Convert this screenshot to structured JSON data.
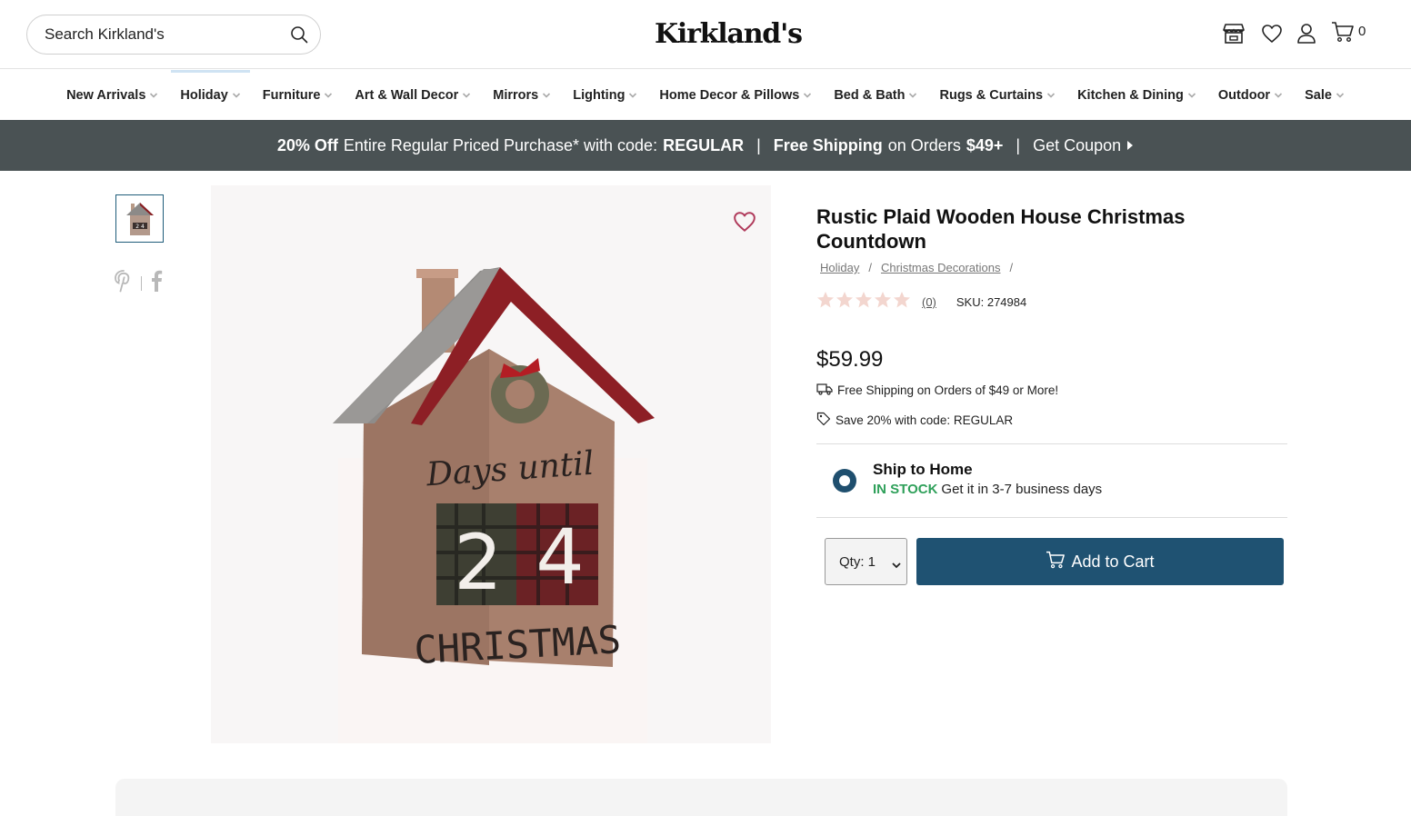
{
  "header": {
    "search_placeholder": "Search Kirkland's",
    "logo": "Kirkland's",
    "cart_count": "0",
    "icons": [
      "store-icon",
      "heart-icon",
      "account-icon",
      "cart-icon"
    ]
  },
  "nav": {
    "items": [
      {
        "label": "New Arrivals"
      },
      {
        "label": "Holiday"
      },
      {
        "label": "Furniture"
      },
      {
        "label": "Art & Wall Decor"
      },
      {
        "label": "Mirrors"
      },
      {
        "label": "Lighting"
      },
      {
        "label": "Home Decor & Pillows"
      },
      {
        "label": "Bed & Bath"
      },
      {
        "label": "Rugs & Curtains"
      },
      {
        "label": "Kitchen & Dining"
      },
      {
        "label": "Outdoor"
      },
      {
        "label": "Sale"
      }
    ]
  },
  "promo": {
    "bold1": "20% Off",
    "text1": "Entire Regular Priced Purchase* with code:",
    "code": "REGULAR",
    "bold2": "Free Shipping",
    "text2": "on Orders",
    "amount": "$49+",
    "cta": "Get Coupon",
    "sep": "|",
    "bg_color": "#4a5254"
  },
  "product": {
    "title": "Rustic Plaid Wooden House Christmas Countdown",
    "breadcrumb": [
      "Holiday",
      "Christmas Decorations"
    ],
    "crumb_sep": "/",
    "rating": 0,
    "review_count": "(0)",
    "sku": "SKU: 274984",
    "price": "$59.99",
    "shipping_note": "Free Shipping on Orders of $49 or More!",
    "save_note": "Save 20% with code: REGULAR",
    "image_text": {
      "line1": "Days until",
      "digit1": "2",
      "digit2": "4",
      "line2": "CHRISTMAS"
    }
  },
  "fulfillment": {
    "option": "Ship to Home",
    "stock": "IN STOCK",
    "eta": "Get it in 3-7 business days"
  },
  "purchase": {
    "qty_label": "Qty: 1",
    "add_to_cart": "Add to Cart",
    "accent": "#1f5272"
  }
}
